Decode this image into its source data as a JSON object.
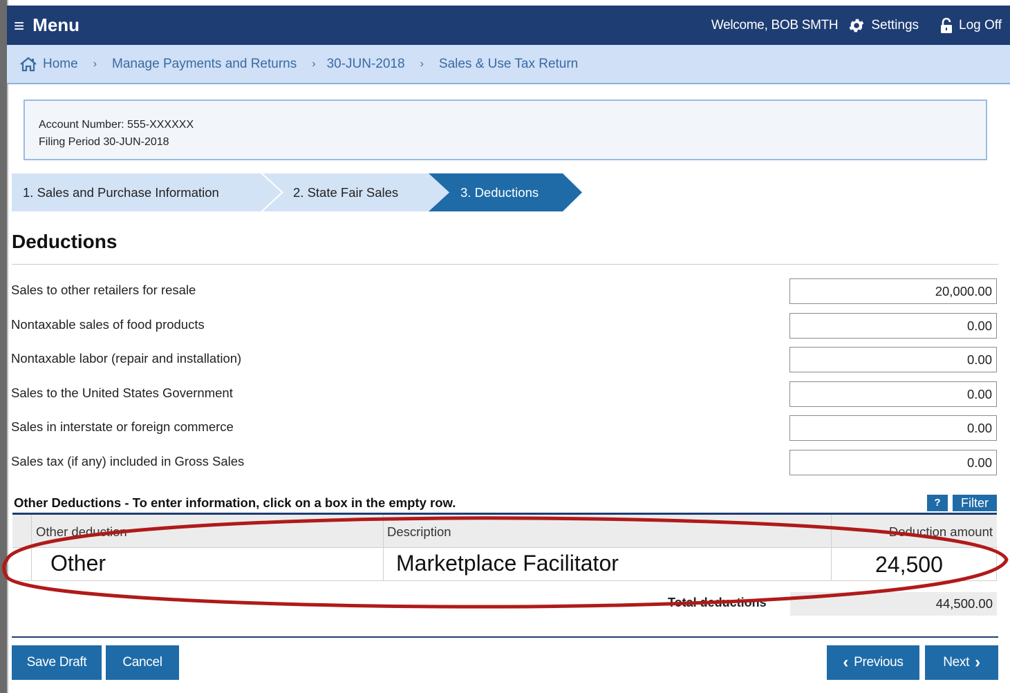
{
  "header": {
    "menu_label": "Menu",
    "welcome": "Welcome, BOB SMTH",
    "settings_label": "Settings",
    "logoff_label": "Log Off"
  },
  "breadcrumb": {
    "items": [
      "Home",
      "Manage Payments and Returns",
      "30-JUN-2018",
      "Sales & Use Tax Return"
    ]
  },
  "account": {
    "account_number": "Account Number: 555-XXXXXX",
    "filing_period": "Filing Period 30-JUN-2018"
  },
  "steps": [
    {
      "label": "1. Sales and Purchase Information",
      "active": false
    },
    {
      "label": "2. State Fair Sales",
      "active": false
    },
    {
      "label": "3. Deductions",
      "active": true
    }
  ],
  "page_title": "Deductions",
  "deductions": [
    {
      "label": "Sales to other retailers for resale",
      "value": "20,000.00"
    },
    {
      "label": "Nontaxable sales of food products",
      "value": "0.00"
    },
    {
      "label": "Nontaxable labor (repair and installation)",
      "value": "0.00"
    },
    {
      "label": "Sales to the United States Government",
      "value": "0.00"
    },
    {
      "label": "Sales in interstate or foreign commerce",
      "value": "0.00"
    },
    {
      "label": "Sales tax (if any) included in Gross Sales",
      "value": "0.00"
    }
  ],
  "other_deductions": {
    "title": "Other Deductions - To enter information, click on a box in the empty row.",
    "help_label": "?",
    "filter_label": "Filter",
    "columns": [
      "Other deduction",
      "Description",
      "Deduction amount"
    ],
    "row": {
      "other": "Other",
      "description": "Marketplace Facilitator",
      "amount": "24,500"
    },
    "total_label": "Total deductions",
    "total_value": "44,500.00"
  },
  "colors": {
    "header_bg": "#1e3d73",
    "breadcrumb_bg": "#cfe0f7",
    "step_active": "#1e6ba8",
    "step_inactive": "#d3e3f6",
    "button_bg": "#1e6ba8",
    "annotation": "#b01a1a"
  },
  "buttons": {
    "save_draft": "Save Draft",
    "cancel": "Cancel",
    "previous": "Previous",
    "next": "Next"
  }
}
